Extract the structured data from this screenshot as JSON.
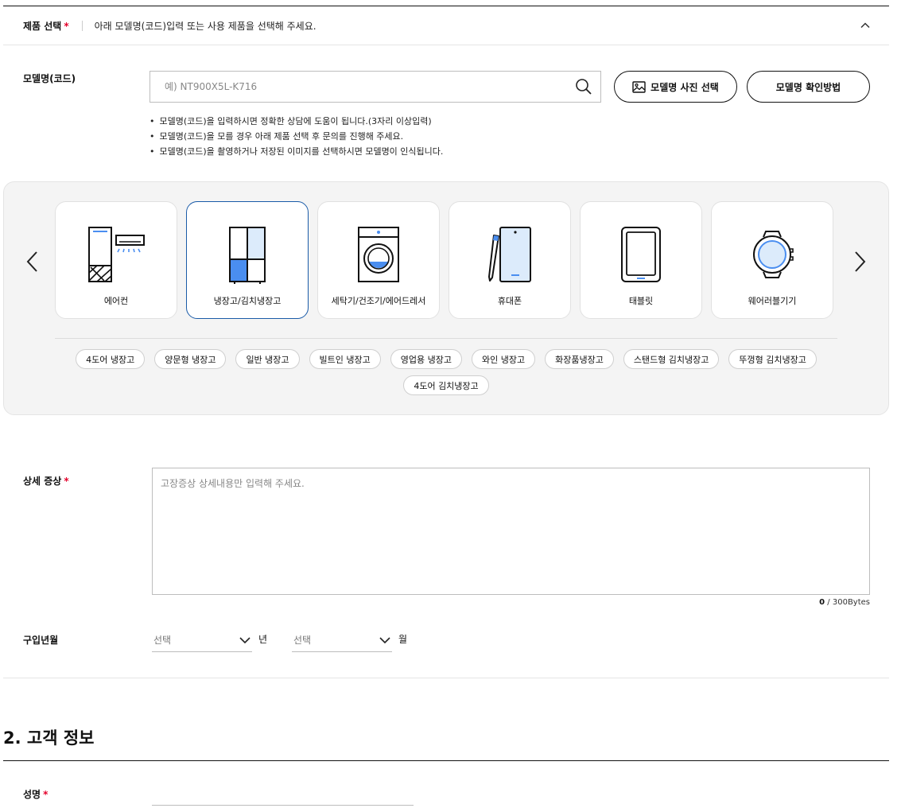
{
  "product_select": {
    "label": "제품 선택",
    "required_mark": "*",
    "description": "아래 모델명(코드)입력 또는 사용 제품을 선택해 주세요."
  },
  "model": {
    "label": "모델명(코드)",
    "placeholder": "예) NT900X5L-K716",
    "photo_button": "모델명 사진 선택",
    "howto_button": "모델명 확인방법",
    "notes": [
      "모델명(코드)을 입력하시면 정확한 상담에 도움이 됩니다.(3자리 이상입력)",
      "모델명(코드)을 모를 경우 아래 제품 선택 후 문의를 진행해 주세요.",
      "모델명(코드)을 촬영하거나 저장된 이미지를 선택하시면 모델명이 인식됩니다."
    ]
  },
  "categories": [
    {
      "name": "에어컨",
      "icon": "air-conditioner-icon"
    },
    {
      "name": "냉장고/김치냉장고",
      "icon": "refrigerator-icon",
      "selected": true
    },
    {
      "name": "세탁기/건조기/에어드레서",
      "icon": "washing-machine-icon"
    },
    {
      "name": "휴대폰",
      "icon": "mobile-phone-icon"
    },
    {
      "name": "태블릿",
      "icon": "tablet-icon"
    },
    {
      "name": "웨어러블기기",
      "icon": "smartwatch-icon"
    }
  ],
  "subcategories": [
    "4도어 냉장고",
    "양문형 냉장고",
    "일반 냉장고",
    "빌트인 냉장고",
    "영업용 냉장고",
    "와인 냉장고",
    "화장품냉장고",
    "스탠드형 김치냉장고",
    "뚜껑형 김치냉장고",
    "4도어 김치냉장고"
  ],
  "symptom": {
    "label": "상세 증상",
    "required_mark": "*",
    "placeholder": "고장증상 상세내용만 입력해 주세요.",
    "byte_count": "0",
    "byte_limit": " / 300Bytes"
  },
  "purchase": {
    "label": "구입년월",
    "year_select": "선택",
    "year_unit": "년",
    "month_select": "선택",
    "month_unit": "월"
  },
  "customer_section": {
    "title": "2. 고객 정보",
    "name_label": "성명",
    "required_mark": "*"
  },
  "colors": {
    "accent_blue": "#1a5ba8",
    "icon_blue": "#4a8ef0",
    "required_red": "#e4002b"
  }
}
